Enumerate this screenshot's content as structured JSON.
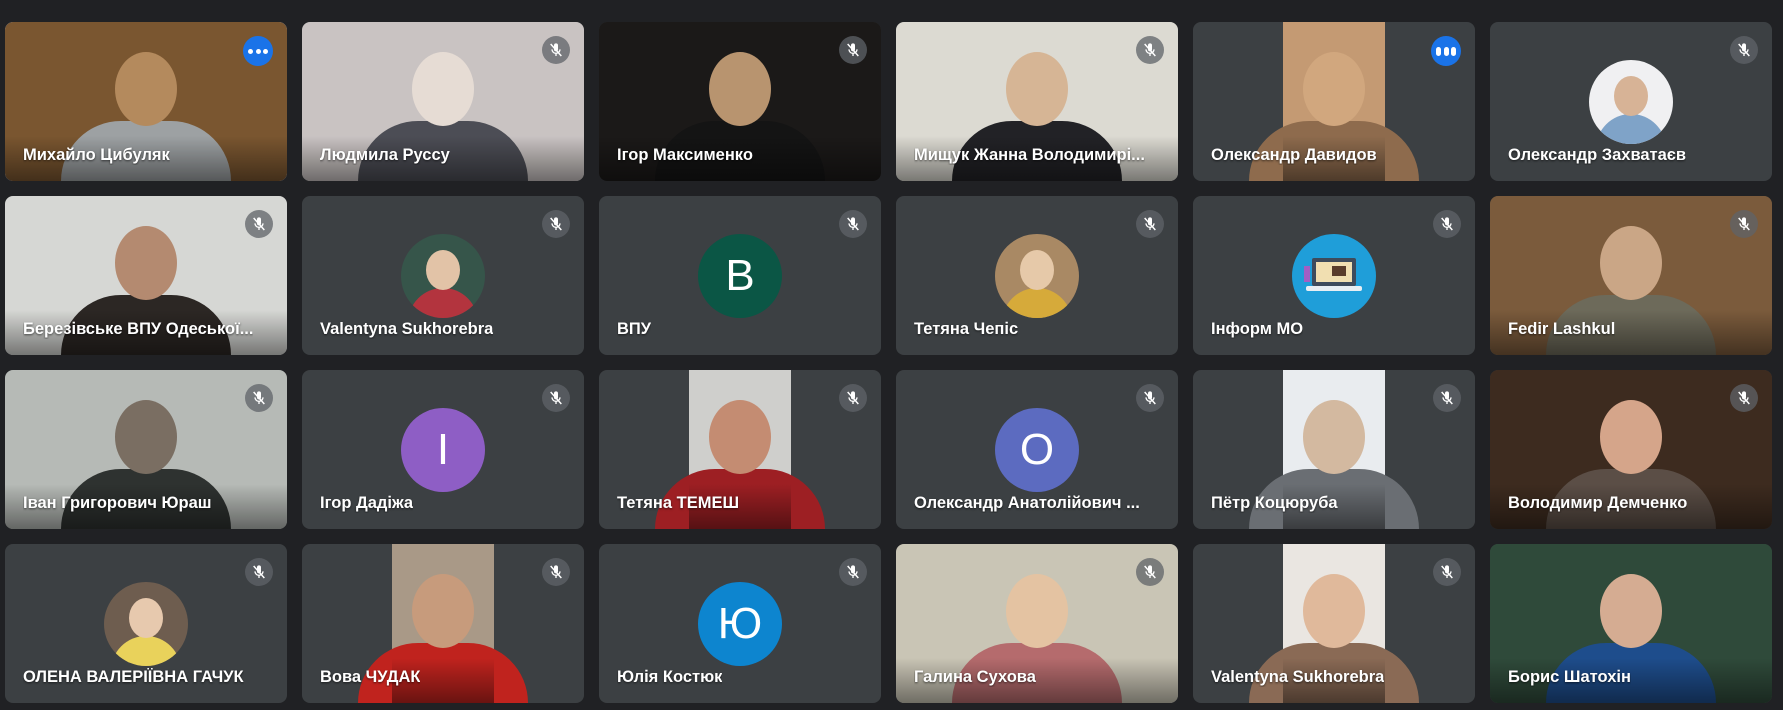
{
  "participants": [
    {
      "name": "Михайло Цибуляк",
      "mic": "speaking",
      "kind": "video",
      "speaking": true,
      "colors": [
        "#7a5630",
        "#b48a5d",
        "#9da1a3"
      ]
    },
    {
      "name": "Людмила Руссу",
      "mic": "muted",
      "kind": "video",
      "colors": [
        "#c9c3c2",
        "#e6dcd4",
        "#4c4d55"
      ]
    },
    {
      "name": "Ігор Максименко",
      "mic": "muted",
      "kind": "video",
      "colors": [
        "#1b1918",
        "#b8946f",
        "#141414"
      ]
    },
    {
      "name": "Мищук Жанна Володимирі...",
      "mic": "muted",
      "kind": "video",
      "colors": [
        "#dcdad2",
        "#d6b595",
        "#222226"
      ]
    },
    {
      "name": "Олександр Давидов",
      "mic": "speaking",
      "kind": "video",
      "strip": true,
      "colors": [
        "#c49a73",
        "#d1a77e",
        "#8e6b4d"
      ]
    },
    {
      "name": "Олександр Захватаєв",
      "mic": "muted",
      "kind": "photo",
      "colors": [
        "#f0f0f2",
        "#d7b396",
        "#7fa3c8"
      ]
    },
    {
      "name": "Березівське ВПУ Одеської...",
      "mic": "muted",
      "kind": "video",
      "colors": [
        "#d6d7d4",
        "#b48a70",
        "#2c2724"
      ]
    },
    {
      "name": "Valentyna Sukhorebra",
      "mic": "muted",
      "kind": "photo",
      "colors": [
        "#36554a",
        "#e2c3a7",
        "#b3343e"
      ]
    },
    {
      "name": "ВПУ",
      "mic": "muted",
      "kind": "initial",
      "initial": "В",
      "colors": [
        "#0b5645"
      ]
    },
    {
      "name": "Тетяна Чепіс",
      "mic": "muted",
      "kind": "photo",
      "colors": [
        "#a98964",
        "#e6c9a9",
        "#d6aa3a"
      ]
    },
    {
      "name": "Інформ МО",
      "mic": "muted",
      "kind": "icon",
      "colors": [
        "#1f9ed9",
        "#f1dfb1",
        "#3e4b5c"
      ]
    },
    {
      "name": "Fedir Lashkul",
      "mic": "muted",
      "kind": "video",
      "colors": [
        "#7b5b3c",
        "#caa686",
        "#6d6a5a"
      ]
    },
    {
      "name": "Іван Григорович Юраш",
      "mic": "muted",
      "kind": "video",
      "colors": [
        "#b6bab6",
        "#7a6e62",
        "#2e3230"
      ]
    },
    {
      "name": "Ігор Дадіжа",
      "mic": "muted",
      "kind": "initial",
      "initial": "І",
      "colors": [
        "#8e5ec5"
      ]
    },
    {
      "name": "Тетяна ТЕМЕШ",
      "mic": "muted",
      "kind": "video",
      "strip": true,
      "colors": [
        "#cfcfcc",
        "#c48c72",
        "#9d1f23"
      ]
    },
    {
      "name": "Олександр Анатолійович ...",
      "mic": "muted",
      "kind": "initial",
      "initial": "О",
      "colors": [
        "#5c6bc0"
      ]
    },
    {
      "name": "Пётр Коцюруба",
      "mic": "muted",
      "kind": "video",
      "strip": true,
      "colors": [
        "#e9ecef",
        "#d3b9a0",
        "#6a6e73"
      ]
    },
    {
      "name": "Володимир Демченко",
      "mic": "muted",
      "kind": "video",
      "colors": [
        "#3d2b1f",
        "#d5a58a",
        "#5b4e46"
      ]
    },
    {
      "name": "ОЛЕНА ВАЛЕРІЇВНА ГАЧУК",
      "mic": "muted",
      "kind": "photo",
      "colors": [
        "#6e5d4f",
        "#e7c9ae",
        "#e9d25b"
      ]
    },
    {
      "name": "Вова ЧУДАК",
      "mic": "muted",
      "kind": "video",
      "strip": true,
      "colors": [
        "#a99987",
        "#c79b7c",
        "#c0231e"
      ]
    },
    {
      "name": "Юлія Костюк",
      "mic": "muted",
      "kind": "initial",
      "initial": "Ю",
      "colors": [
        "#0d85cf"
      ]
    },
    {
      "name": "Галина Сухова",
      "mic": "muted",
      "kind": "video",
      "colors": [
        "#c9c5b5",
        "#e4c3a2",
        "#b56b6d"
      ]
    },
    {
      "name": "Valentyna Sukhorebra",
      "mic": "muted",
      "kind": "video",
      "strip": true,
      "colors": [
        "#eae6e1",
        "#e0b99b",
        "#8a6a55"
      ]
    },
    {
      "name": "Борис Шатохін",
      "mic": "none",
      "kind": "video",
      "colors": [
        "#2f4a3a",
        "#d5ac92",
        "#1e4d8c"
      ]
    }
  ]
}
